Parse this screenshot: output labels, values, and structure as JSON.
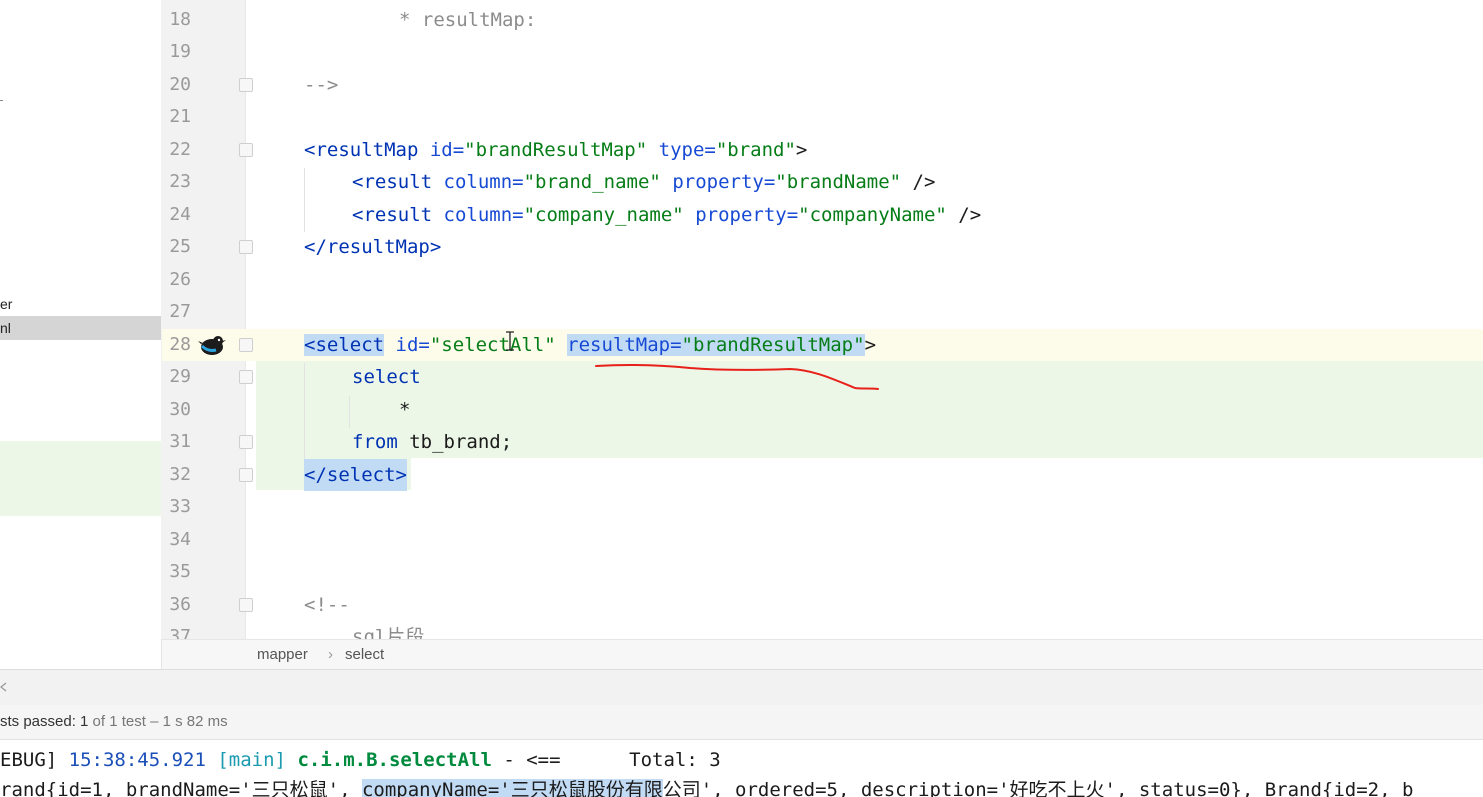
{
  "sidebar": {
    "items": [
      {
        "label": "er"
      },
      {
        "label": "nl"
      }
    ]
  },
  "editor": {
    "lines": [
      {
        "num": "18",
        "text": "* resultMap:"
      },
      {
        "num": "19",
        "text": ""
      },
      {
        "num": "20",
        "text": "-->"
      },
      {
        "num": "21",
        "text": ""
      },
      {
        "num": "22",
        "text": "<resultMap id=\"brandResultMap\" type=\"brand\">"
      },
      {
        "num": "23",
        "text": "<result column=\"brand_name\" property=\"brandName\" />"
      },
      {
        "num": "24",
        "text": "<result column=\"company_name\" property=\"companyName\" />"
      },
      {
        "num": "25",
        "text": "</resultMap>"
      },
      {
        "num": "26",
        "text": ""
      },
      {
        "num": "27",
        "text": ""
      },
      {
        "num": "28",
        "text": "<select id=\"selectAll\" resultMap=\"brandResultMap\">"
      },
      {
        "num": "29",
        "text": "select"
      },
      {
        "num": "30",
        "text": "*"
      },
      {
        "num": "31",
        "text": "from tb_brand;"
      },
      {
        "num": "32",
        "text": "</select>"
      },
      {
        "num": "33",
        "text": ""
      },
      {
        "num": "34",
        "text": ""
      },
      {
        "num": "35",
        "text": ""
      },
      {
        "num": "36",
        "text": "<!--"
      },
      {
        "num": "37",
        "text": "sql片段"
      }
    ],
    "tokens": {
      "l18": "* resultMap:",
      "l20": "-->",
      "l22_open": "<resultMap",
      "l22_attr1": " id=",
      "l22_val1": "\"brandResultMap\"",
      "l22_attr2": " type=",
      "l22_val2": "\"brand\"",
      "l22_close": ">",
      "l23_open": "<result",
      "l23_attr1": " column=",
      "l23_val1": "\"brand_name\"",
      "l23_attr2": " property=",
      "l23_val2": "\"brandName\"",
      "l23_close": " />",
      "l24_open": "<result",
      "l24_attr1": " column=",
      "l24_val1": "\"company_name\"",
      "l24_attr2": " property=",
      "l24_val2": "\"companyName\"",
      "l24_close": " />",
      "l25": "</resultMap>",
      "l28_open": "<select",
      "l28_attr1": " id=",
      "l28_val1": "\"selectAll\"",
      "l28_sp": " ",
      "l28_attr2": "resultMap=",
      "l28_val2": "\"brandResultMap\"",
      "l28_close": ">",
      "l29": "select",
      "l30": "*",
      "l31_kw": "from",
      "l31_rest": " tb_brand;",
      "l32": "</select>",
      "l36": "<!--",
      "l37": "sql片段"
    }
  },
  "breadcrumb": {
    "items": [
      "mapper",
      "select"
    ],
    "separator": "›"
  },
  "tests": {
    "prefix": "sts passed: ",
    "count": "1",
    "suffix": " of 1 test – 1 s 82 ms"
  },
  "console": {
    "line1": {
      "level": "EBUG] ",
      "time": "15:38:45.921",
      "thread": " [main] ",
      "logger": "c.i.m.B.selectAll",
      "msg": " - <==      Total: 3"
    },
    "line2": {
      "part1": "rand{id=1, brandName='三只松鼠', ",
      "highlight": "companyName='三只松鼠股份有限",
      "part2": "公司', ordered=5, description='好吃不上火', status=0}, Brand{id=2, b"
    }
  },
  "colors": {
    "tag": "#0033b3",
    "value": "#067d17",
    "comment": "#8c8c8c",
    "selection": "#c2dbf5",
    "annotation": "#e8201a"
  }
}
